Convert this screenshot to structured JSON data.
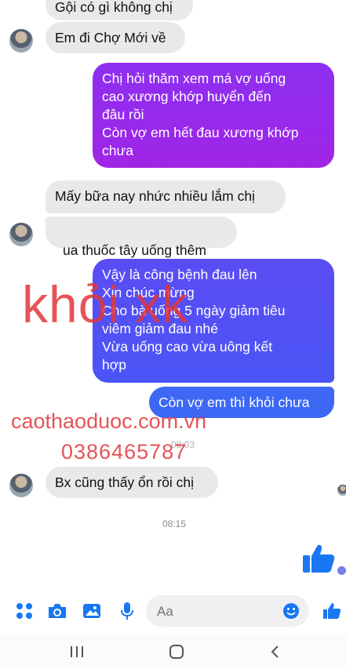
{
  "messages": [
    {
      "id": "m0",
      "text": "Gội có gì không chị"
    },
    {
      "id": "m1",
      "text": "Em đi Chợ Mới về"
    },
    {
      "id": "m2",
      "text": "Chị hỏi thăm xem má vợ uống\ncao xương khớp   huyển đến\nđâu rồi\nCòn vợ em hết đau xương khớp\nchưa"
    },
    {
      "id": "m3",
      "text": "Mấy bữa nay nhức nhiều lắm chị"
    },
    {
      "id": "m4",
      "text": "ua thuốc tây uống thêm"
    },
    {
      "id": "m5",
      "text": "Vậy là công bệnh  đau lên\nXin chúc mừng\nCho bà uống 5 ngày giảm tiêu\nviêm giảm đau nhé\nVừa uống  cao vừa uông  kết\nhợp"
    },
    {
      "id": "m6",
      "text": "Còn vợ em thì khỏi chưa"
    },
    {
      "id": "m7",
      "text": "Bx cũng thấy ổn rồi chị"
    }
  ],
  "timestamps": {
    "t1": "08:03",
    "t2": "08:15"
  },
  "watermark": {
    "brand": "khỏi xk",
    "url": "caothaoduoc.com.vn",
    "phone": "0386465787"
  },
  "composer": {
    "placeholder": "Aa"
  },
  "colors": {
    "messenger_blue": "#1877f2",
    "watermark_red": "#e2363a",
    "bubble_gray": "#e9e9eb"
  },
  "icons": [
    "menu-dots-icon",
    "camera-icon",
    "gallery-icon",
    "microphone-icon",
    "emoji-icon",
    "like-icon",
    "thumbs-up-sticker-icon",
    "seen-avatar-icon"
  ]
}
